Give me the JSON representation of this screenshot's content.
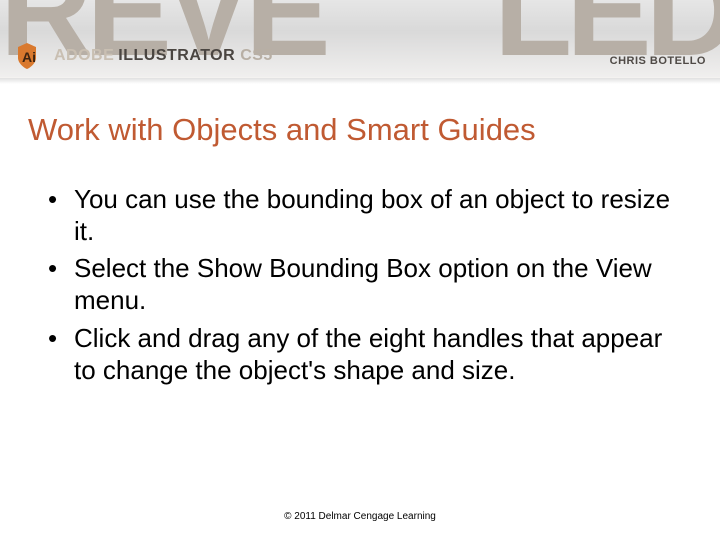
{
  "header": {
    "bg_word_left": "REVE",
    "bg_word_right": "LED",
    "adobe": "ADOBE",
    "product": "ILLUSTRATOR",
    "version": "CS5",
    "author": "CHRIS BOTELLO"
  },
  "slide": {
    "title": "Work with Objects and Smart Guides",
    "bullets": [
      "You can use the bounding box of an object to resize it.",
      "Select the Show Bounding Box option on the View menu.",
      "Click and drag any of the eight handles that appear to change the object's shape and size."
    ]
  },
  "footer": {
    "copyright": "© 2011 Delmar Cengage Learning"
  }
}
